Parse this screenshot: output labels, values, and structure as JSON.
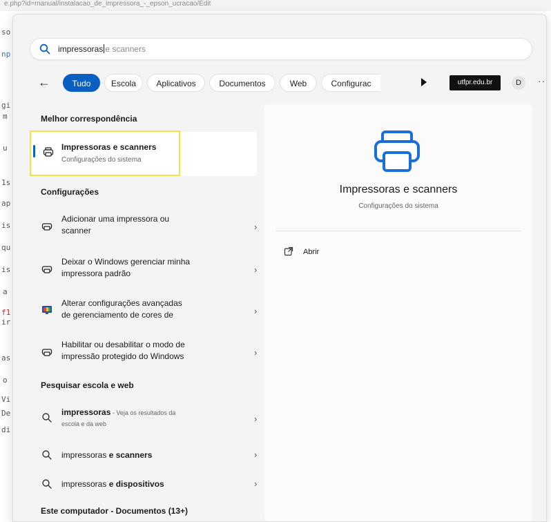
{
  "background": {
    "url_fragment": "e.php?id=manual/instalacao_de_impressora_-_epson_ucracao/Edit",
    "fragments": [
      {
        "text": "so"
      },
      {
        "text": "np"
      },
      {
        "text": "gi"
      },
      {
        "text": "m"
      },
      {
        "text": "u"
      },
      {
        "text": "1s"
      },
      {
        "text": "ap"
      },
      {
        "text": "is"
      },
      {
        "text": "qu"
      },
      {
        "text": "is"
      },
      {
        "text": "a"
      },
      {
        "text": "f1"
      },
      {
        "text": "ir"
      },
      {
        "text": "as"
      },
      {
        "text": "o"
      },
      {
        "text": "Vi"
      },
      {
        "text": "De"
      },
      {
        "text": "di"
      }
    ]
  },
  "search": {
    "query": "impressoras",
    "suggestion": "e scanners",
    "icon": "search-icon"
  },
  "filters": {
    "back_icon": "back-arrow-icon",
    "chips": [
      {
        "label": "Tudo",
        "active": true
      },
      {
        "label": "Escola",
        "active": false
      },
      {
        "label": "Aplicativos",
        "active": false
      },
      {
        "label": "Documentos",
        "active": false
      },
      {
        "label": "Web",
        "active": false
      },
      {
        "label": "Configurac",
        "active": false
      }
    ],
    "org_label": "utfpr.edu.br",
    "avatar_initial": "D",
    "more_label": "···"
  },
  "best_match": {
    "heading": "Melhor correspondência",
    "title": "Impressoras e scanners",
    "subtitle": "Configurações do sistema"
  },
  "settings": {
    "heading": "Configurações",
    "items": [
      {
        "line1": "Adicionar uma impressora ou",
        "line2": "scanner"
      },
      {
        "line1": "Deixar o Windows gerenciar minha",
        "line2": "impressora padrão"
      },
      {
        "line1": "Alterar configurações avançadas",
        "line2": "de gerenciamento de cores de"
      },
      {
        "line1": "Habilitar ou desabilitar o modo de",
        "line2": "impressão protegido do Windows"
      }
    ]
  },
  "web": {
    "heading": "Pesquisar escola e web",
    "items": [
      {
        "bold": "impressoras",
        "rest": " - Veja os resultados da",
        "line2": "escola e da web"
      },
      {
        "normal": "impressoras ",
        "bold": "e scanners"
      },
      {
        "normal": "impressoras ",
        "bold": "e dispositivos"
      }
    ]
  },
  "this_pc": {
    "heading": "Este computador - Documentos (13+)"
  },
  "detail": {
    "title": "Impressoras e scanners",
    "subtitle": "Configurações do sistema",
    "open_label": "Abrir"
  },
  "colors": {
    "accent": "#0a5fc2",
    "highlight": "#f2e540"
  }
}
